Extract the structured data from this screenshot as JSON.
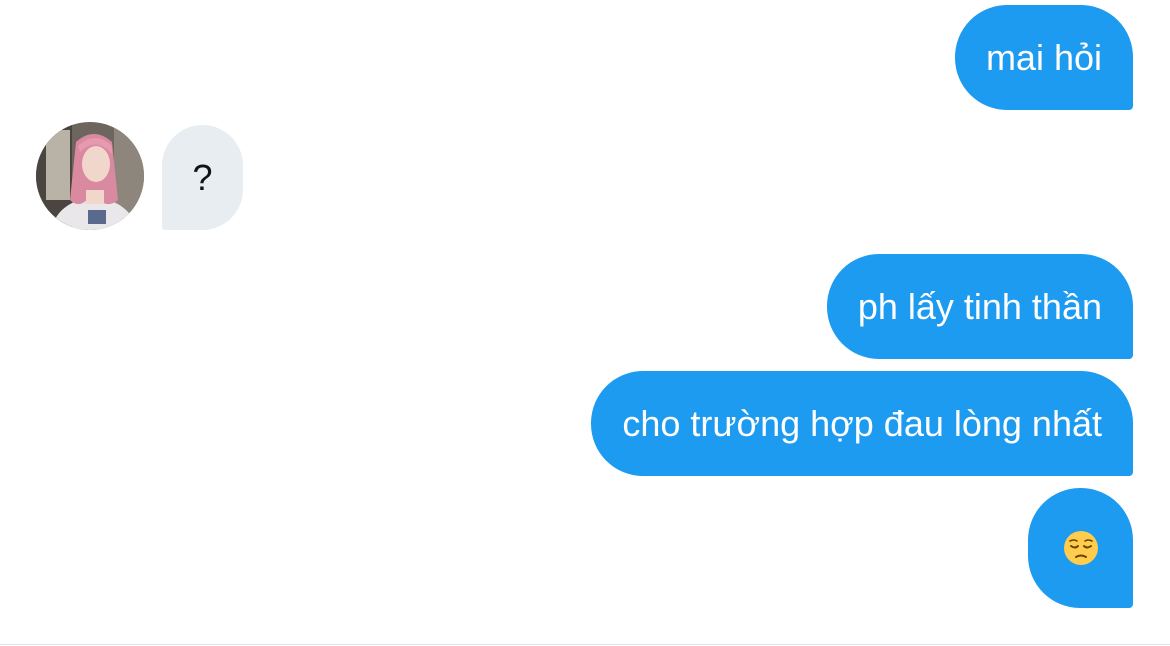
{
  "conversation": {
    "messages": [
      {
        "direction": "outgoing",
        "text": "mai hỏi"
      },
      {
        "direction": "incoming",
        "text": "?"
      },
      {
        "direction": "outgoing",
        "text": "ph lấy tinh thần"
      },
      {
        "direction": "outgoing",
        "text": "cho trường hợp đau lòng nhất"
      },
      {
        "direction": "outgoing",
        "text": "😔"
      }
    ]
  },
  "colors": {
    "outgoing_bubble": "#1d9bf0",
    "incoming_bubble": "#e8edf1",
    "outgoing_text": "#ffffff",
    "incoming_text": "#0f1419",
    "background": "#ffffff"
  },
  "icons": {
    "emoji": "pensive-face-emoji",
    "avatar": "contact-avatar-photo"
  }
}
